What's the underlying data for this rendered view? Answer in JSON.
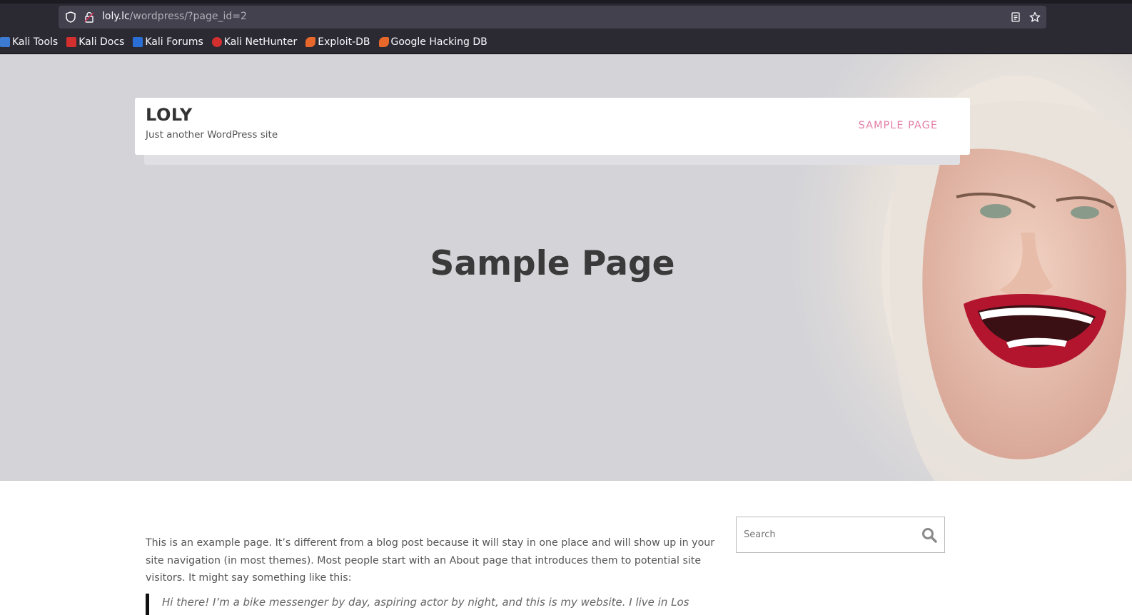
{
  "browser": {
    "url_host": "loly.lc",
    "url_path": "/wordpress/?page_id=2",
    "bookmarks": [
      {
        "label": "Kali Tools",
        "icon": "kali-tools-icon",
        "color": "#3b7bd4"
      },
      {
        "label": "Kali Docs",
        "icon": "kali-docs-icon",
        "color": "#d32f2f"
      },
      {
        "label": "Kali Forums",
        "icon": "kali-forums-icon",
        "color": "#2a6fd6"
      },
      {
        "label": "Kali NetHunter",
        "icon": "kali-nethunter-icon",
        "color": "#d32f2f"
      },
      {
        "label": "Exploit-DB",
        "icon": "exploit-db-icon",
        "color": "#e8682c"
      },
      {
        "label": "Google Hacking DB",
        "icon": "ghdb-icon",
        "color": "#e8682c"
      }
    ]
  },
  "site": {
    "title": "LOLY",
    "tagline": "Just another WordPress site",
    "nav": {
      "sample_page": "SAMPLE PAGE"
    },
    "accent_color": "#e27fa6"
  },
  "hero": {
    "title": "Sample Page"
  },
  "content": {
    "paragraph": "This is an example page. It’s different from a blog post because it will stay in one place and will show up in your site navigation (in most themes). Most people start with an About page that introduces them to potential site visitors. It might say something like this:",
    "quote": "Hi there! I’m a bike messenger by day, aspiring actor by night, and this is my website. I live in Los"
  },
  "sidebar": {
    "search_placeholder": "Search"
  }
}
